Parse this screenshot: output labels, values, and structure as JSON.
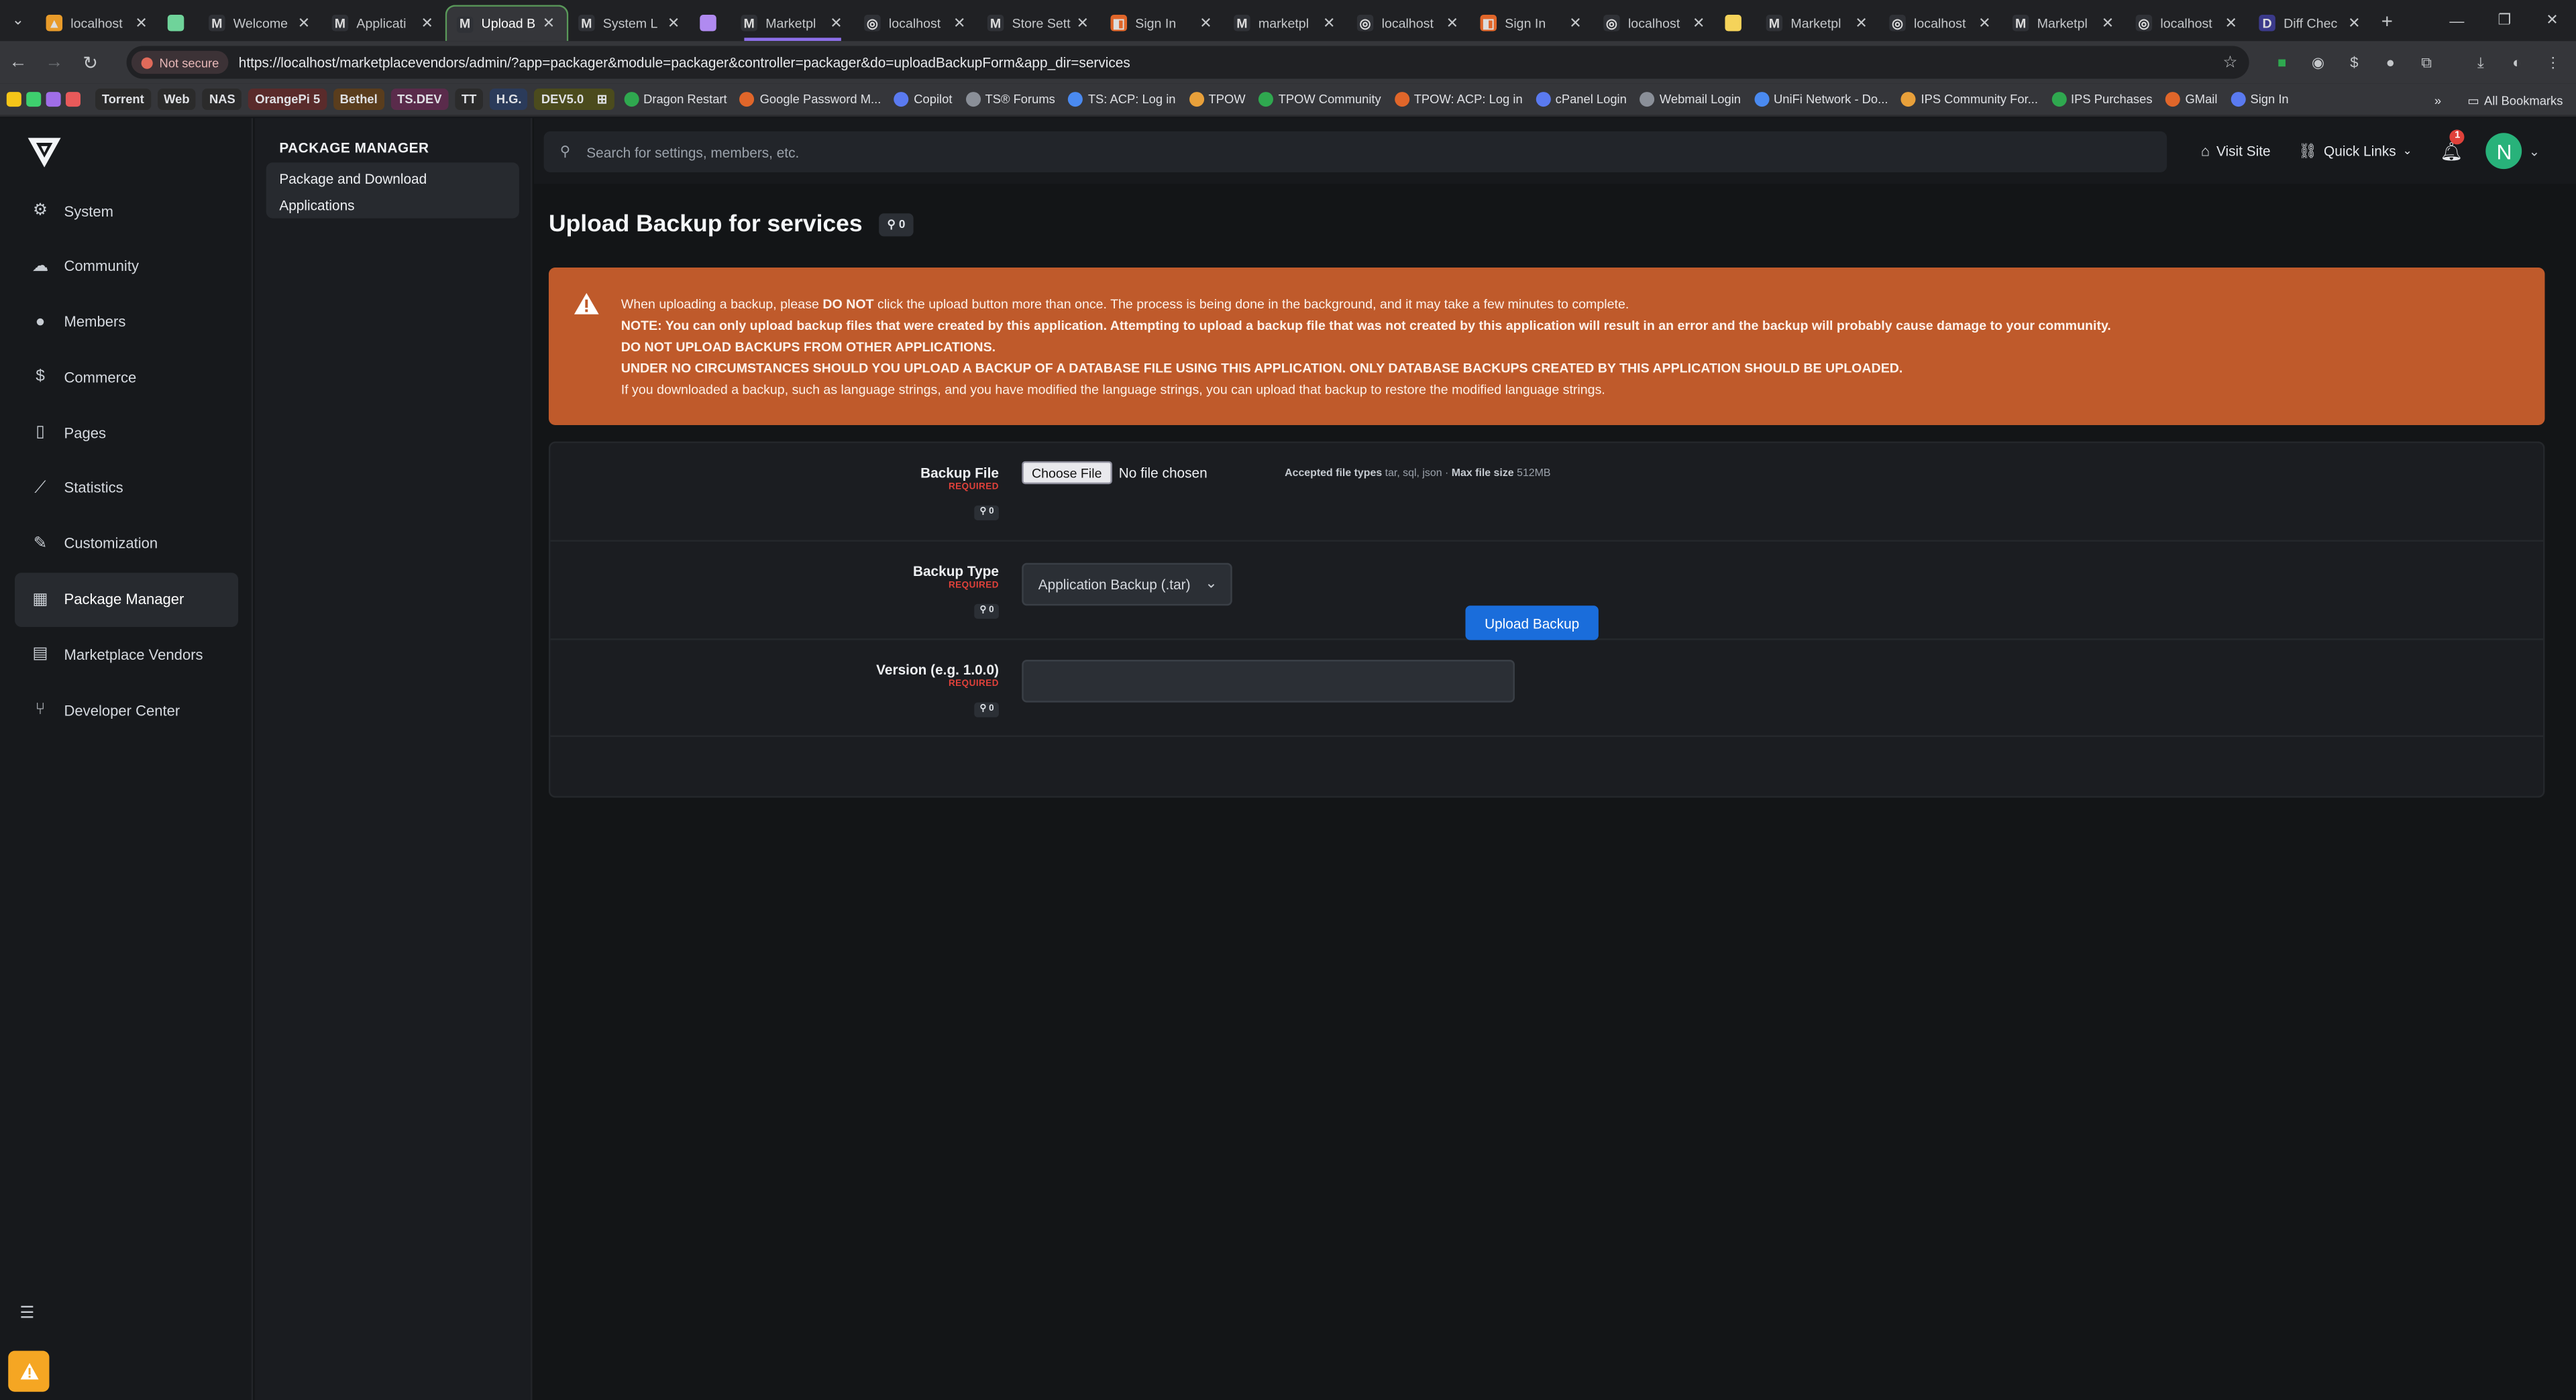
{
  "browser": {
    "tabs": [
      {
        "title": "localhost",
        "favicon": "ips-icon",
        "active": false
      },
      {
        "title": "",
        "favicon": "green-square-icon",
        "active": false,
        "pinned": true
      },
      {
        "title": "Welcome",
        "favicon": "m-icon",
        "active": false
      },
      {
        "title": "Applicati",
        "favicon": "m-icon",
        "active": false
      },
      {
        "title": "Upload B",
        "favicon": "m-icon",
        "active": true
      },
      {
        "title": "System L",
        "favicon": "m-icon",
        "active": false
      },
      {
        "title": "",
        "favicon": "purple-square-icon",
        "active": false,
        "pinned": true
      },
      {
        "title": "Marketpl",
        "favicon": "m-icon",
        "active": false
      },
      {
        "title": "localhost",
        "favicon": "globe-icon",
        "active": false
      },
      {
        "title": "Store Sett",
        "favicon": "m-icon",
        "active": false
      },
      {
        "title": "Sign In",
        "favicon": "orange-icon",
        "active": false
      },
      {
        "title": "marketpl",
        "favicon": "m-icon",
        "active": false
      },
      {
        "title": "localhost",
        "favicon": "globe-icon",
        "active": false
      },
      {
        "title": "Sign In",
        "favicon": "orange-icon",
        "active": false
      },
      {
        "title": "localhost",
        "favicon": "globe-icon",
        "active": false
      },
      {
        "title": "",
        "favicon": "yellow-square-icon",
        "active": false,
        "pinned": true
      },
      {
        "title": "Marketpl",
        "favicon": "m-icon",
        "active": false
      },
      {
        "title": "localhost",
        "favicon": "globe-icon",
        "active": false
      },
      {
        "title": "Marketpl",
        "favicon": "m-icon",
        "active": false
      },
      {
        "title": "localhost",
        "favicon": "globe-icon",
        "active": false
      },
      {
        "title": "Diff Chec",
        "favicon": "diff-icon",
        "active": false
      }
    ],
    "not_secure": "Not secure",
    "url": "https://localhost/marketplacevendors/admin/?app=packager&module=packager&controller=packager&do=uploadBackupForm&app_dir=services",
    "bookmarks": [
      {
        "label": "Torrent",
        "tag": true,
        "color": "#2b2b2b"
      },
      {
        "label": "Web",
        "tag": true,
        "color": "#2b2b2b"
      },
      {
        "label": "NAS",
        "tag": true,
        "color": "#2b2b2b"
      },
      {
        "label": "OrangePi 5",
        "tag": true,
        "color": "#5a2b2b"
      },
      {
        "label": "Bethel",
        "tag": true,
        "color": "#5a3d1d"
      },
      {
        "label": "TS.DEV",
        "tag": true,
        "color": "#5a2b4b"
      },
      {
        "label": "TT",
        "tag": true,
        "color": "#2b2b2b"
      },
      {
        "label": "H.G.",
        "tag": true,
        "color": "#2b3b5a"
      },
      {
        "label": "DEV5.0",
        "tag": true,
        "color": "#4b4b1d"
      },
      {
        "label": "Dragon Restart",
        "tag": false
      },
      {
        "label": "Google Password M...",
        "tag": false
      },
      {
        "label": "Copilot",
        "tag": false
      },
      {
        "label": "TS® Forums",
        "tag": false
      },
      {
        "label": "TS: ACP: Log in",
        "tag": false
      },
      {
        "label": "TPOW",
        "tag": false
      },
      {
        "label": "TPOW Community",
        "tag": false
      },
      {
        "label": "TPOW: ACP: Log in",
        "tag": false
      },
      {
        "label": "cPanel Login",
        "tag": false
      },
      {
        "label": "Webmail Login",
        "tag": false
      },
      {
        "label": "UniFi Network - Do...",
        "tag": false
      },
      {
        "label": "IPS Community For...",
        "tag": false
      },
      {
        "label": "IPS Purchases",
        "tag": false
      },
      {
        "label": "GMail",
        "tag": false
      },
      {
        "label": "Sign In",
        "tag": false
      }
    ],
    "all_bookmarks": "All Bookmarks",
    "overflow": "»"
  },
  "nav": {
    "items": [
      {
        "label": "System",
        "icon": "gears-icon",
        "active": false
      },
      {
        "label": "Community",
        "icon": "comments-icon",
        "active": false
      },
      {
        "label": "Members",
        "icon": "user-icon",
        "active": false
      },
      {
        "label": "Commerce",
        "icon": "dollar-icon",
        "active": false
      },
      {
        "label": "Pages",
        "icon": "file-icon",
        "active": false
      },
      {
        "label": "Statistics",
        "icon": "chart-line-icon",
        "active": false
      },
      {
        "label": "Customization",
        "icon": "brush-icon",
        "active": false
      },
      {
        "label": "Package Manager",
        "icon": "box-icon",
        "active": true
      },
      {
        "label": "Marketplace Vendors",
        "icon": "store-icon",
        "active": false
      },
      {
        "label": "Developer Center",
        "icon": "code-branch-icon",
        "active": false
      }
    ]
  },
  "subnav": {
    "heading": "PACKAGE MANAGER",
    "item_line1": "Package and Download",
    "item_line2": "Applications"
  },
  "topbar": {
    "search_placeholder": "Search for settings, members, etc.",
    "visit_site": "Visit Site",
    "quick_links": "Quick Links",
    "notifications_count": "1",
    "avatar_letter": "N"
  },
  "page": {
    "title": "Upload Backup for services",
    "title_chip": "0",
    "alert": {
      "line1_pre": "When uploading a backup, please ",
      "line1_bold": "DO NOT",
      "line1_post": " click the upload button more than once. The process is being done in the background, and it may take a few minutes to complete.",
      "line2": "NOTE: You can only upload backup files that were created by this application. Attempting to upload a backup file that was not created by this application will result in an error and the backup will probably cause damage to your community.",
      "line3": "DO NOT UPLOAD BACKUPS FROM OTHER APPLICATIONS.",
      "line4": "UNDER NO CIRCUMSTANCES SHOULD YOU UPLOAD A BACKUP OF A DATABASE FILE USING THIS APPLICATION. ONLY DATABASE BACKUPS CREATED BY THIS APPLICATION SHOULD BE UPLOADED.",
      "line5": "If you downloaded a backup, such as language strings, and you have modified the language strings, you can upload that backup to restore the modified language strings."
    },
    "form": {
      "required": "REQUIRED",
      "backup_file": {
        "label": "Backup File",
        "chip": "0",
        "button": "Choose File",
        "no_file": "No file chosen",
        "accepted_label": "Accepted file types",
        "accepted_value": "tar, sql, json",
        "max_label": "Max file size",
        "max_value": "512MB"
      },
      "backup_type": {
        "label": "Backup Type",
        "chip": "0",
        "selected": "Application Backup (.tar)"
      },
      "version": {
        "label": "Version (e.g. 1.0.0)",
        "chip": "0",
        "value": ""
      },
      "submit": "Upload Backup"
    }
  },
  "colors": {
    "alert_bg": "#bf5a2b",
    "primary_button": "#1a6ddb",
    "required": "#e0413a",
    "avatar": "#28b27a"
  }
}
